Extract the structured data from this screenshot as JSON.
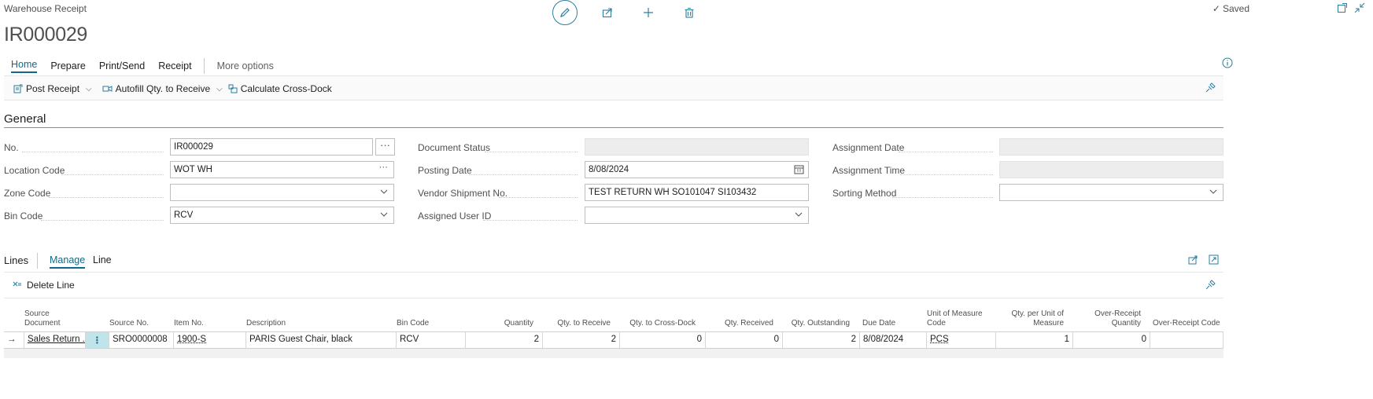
{
  "window": {
    "title": "Warehouse Receipt",
    "doc_number": "IR000029",
    "saved_label": "Saved"
  },
  "menu": {
    "items": [
      "Home",
      "Prepare",
      "Print/Send",
      "Receipt"
    ],
    "more": "More options"
  },
  "actions": {
    "post_receipt": "Post Receipt",
    "autofill": "Autofill Qty. to Receive",
    "cross_dock": "Calculate Cross-Dock"
  },
  "general": {
    "title": "General",
    "no_label": "No.",
    "no_value": "IR000029",
    "location_label": "Location Code",
    "location_value": "WOT WH",
    "zone_label": "Zone Code",
    "zone_value": "",
    "bin_label": "Bin Code",
    "bin_value": "RCV",
    "doc_status_label": "Document Status",
    "posting_date_label": "Posting Date",
    "posting_date_value": "8/08/2024",
    "vendor_ship_label": "Vendor Shipment No.",
    "vendor_ship_value": "TEST RETURN WH SO101047 SI103432",
    "assigned_user_label": "Assigned User ID",
    "assigned_user_value": "",
    "assign_date_label": "Assignment Date",
    "assign_time_label": "Assignment Time",
    "sorting_label": "Sorting Method",
    "sorting_value": ""
  },
  "lines": {
    "title": "Lines",
    "tabs": [
      "Manage",
      "Line"
    ],
    "delete_line": "Delete Line",
    "columns": {
      "source_doc_1": "Source",
      "source_doc_2": "Document",
      "source_no": "Source No.",
      "item_no": "Item No.",
      "description": "Description",
      "bin_code": "Bin Code",
      "quantity": "Quantity",
      "qty_to_receive": "Qty. to Receive",
      "qty_cross_dock": "Qty. to Cross-Dock",
      "qty_received": "Qty. Received",
      "qty_outstanding": "Qty. Outstanding",
      "due_date": "Due Date",
      "uom_1": "Unit of Measure",
      "uom_2": "Code",
      "qty_per_uom_1": "Qty. per Unit of",
      "qty_per_uom_2": "Measure",
      "over_receipt_qty_1": "Over-Receipt",
      "over_receipt_qty_2": "Quantity",
      "over_receipt_code": "Over-Receipt Code"
    },
    "row": {
      "source_doc": "Sales Return ...",
      "source_no": "SRO0000008",
      "item_no": "1900-S",
      "description": "PARIS Guest Chair, black",
      "bin_code": "RCV",
      "quantity": "2",
      "qty_to_receive": "2",
      "qty_cross_dock": "0",
      "qty_received": "0",
      "qty_outstanding": "2",
      "due_date": "8/08/2024",
      "uom": "PCS",
      "qty_per_uom": "1",
      "over_receipt_qty": "0",
      "over_receipt_code": ""
    }
  }
}
